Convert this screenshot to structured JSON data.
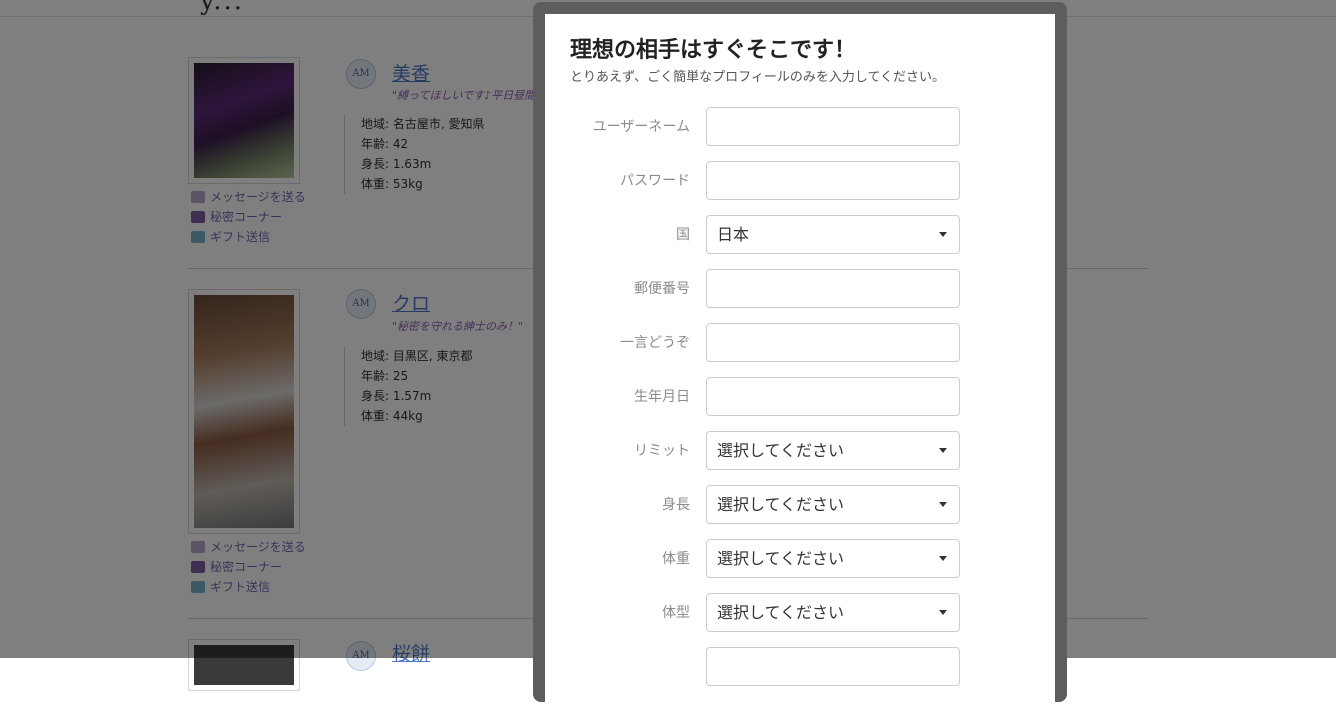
{
  "background": {
    "logo_fragment": "y...",
    "profiles": [
      {
        "badge": "AM",
        "name": "美香",
        "quote": "\"縛ってほしいです♪平日昼間…",
        "stats": [
          "地域: 名古屋市, 愛知県",
          "年齢: 42",
          "身長: 1.63m",
          "体重: 53kg"
        ],
        "actions": [
          "メッセージを送る",
          "秘密コーナー",
          "ギフト送信"
        ]
      },
      {
        "badge": "AM",
        "name": "クロ",
        "quote": "\"秘密を守れる紳士のみ！\"",
        "stats": [
          "地域: 目黒区, 東京都",
          "年齢: 25",
          "身長: 1.57m",
          "体重: 44kg"
        ],
        "actions": [
          "メッセージを送る",
          "秘密コーナー",
          "ギフト送信"
        ]
      },
      {
        "badge": "AM",
        "name": "桜餅"
      }
    ]
  },
  "modal": {
    "title": "理想の相手はすぐそこです！",
    "subtitle": "とりあえず、ごく簡単なプロフィールのみを入力してください。",
    "fields": [
      {
        "label": "ユーザーネーム",
        "value": ""
      },
      {
        "label": "パスワード",
        "value": ""
      },
      {
        "label": "国",
        "value": "日本"
      },
      {
        "label": "郵便番号",
        "value": ""
      },
      {
        "label": "一言どうぞ",
        "value": ""
      },
      {
        "label": "生年月日",
        "value": ""
      },
      {
        "label": "リミット",
        "value": "選択してください"
      },
      {
        "label": "身長",
        "value": "選択してください"
      },
      {
        "label": "体重",
        "value": "選択してください"
      },
      {
        "label": "体型",
        "value": "選択してください"
      }
    ]
  },
  "colors": {
    "overlay": "#000000",
    "link_name": "#4f79c8",
    "quote": "#8e5fb0"
  }
}
